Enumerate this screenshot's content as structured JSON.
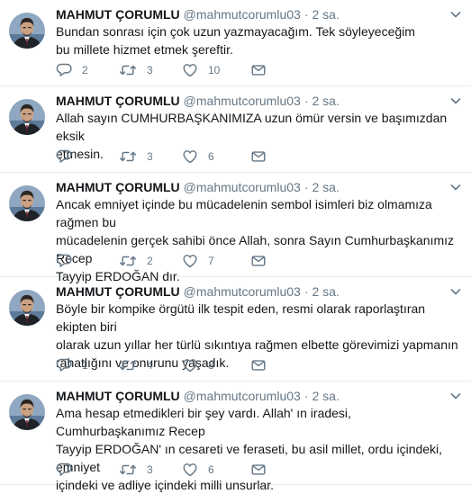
{
  "tweets": [
    {
      "author_name": "MAHMUT ÇORUMLU",
      "handle": "@mahmutcorumlu03",
      "separator": "·",
      "time": "2 sa.",
      "text": "Bundan sonrası için çok uzun yazmayacağım. Tek söyleyeceğim\nbu millete hizmet etmek şereftir.",
      "replies": "2",
      "retweets": "3",
      "likes": "10"
    },
    {
      "author_name": "MAHMUT ÇORUMLU",
      "handle": "@mahmutcorumlu03",
      "separator": "·",
      "time": "2 sa.",
      "text": "Allah sayın CUMHURBAŞKANIMIZA uzun ömür versin ve başımızdan eksik\netmesin.",
      "replies": "",
      "retweets": "3",
      "likes": "6"
    },
    {
      "author_name": "MAHMUT ÇORUMLU",
      "handle": "@mahmutcorumlu03",
      "separator": "·",
      "time": "2 sa.",
      "text": "Ancak emniyet içinde bu mücadelenin sembol isimleri biz olmamıza rağmen bu\nmücadelenin gerçek sahibi önce Allah, sonra Sayın Cumhurbaşkanımız Recep\nTayyip ERDOĞAN dır.",
      "replies": "",
      "retweets": "2",
      "likes": "7"
    },
    {
      "author_name": "MAHMUT ÇORUMLU",
      "handle": "@mahmutcorumlu03",
      "separator": "·",
      "time": "2 sa.",
      "text": "Böyle bir kompike örgütü ilk tespit eden, resmi olarak raporlaştıran ekipten biri\nolarak uzun yıllar her türlü sıkıntıya rağmen  elbette görevimizi yapmanın\nrahatlığını ve onurunu yaşadık.",
      "replies": "1",
      "retweets": "4",
      "likes": "8"
    },
    {
      "author_name": "MAHMUT ÇORUMLU",
      "handle": "@mahmutcorumlu03",
      "separator": "·",
      "time": "2 sa.",
      "text": "Ama hesap etmedikleri bir şey vardı. Allah' ın iradesi,  Cumhurbaşkanımız Recep\nTayyip ERDOĞAN' ın cesareti ve feraseti, bu asil millet, ordu içindeki, emniyet\niçindeki ve adliye içindeki milli unsurlar.",
      "replies": "",
      "retweets": "3",
      "likes": "6"
    }
  ],
  "colors": {
    "text": "#14171a",
    "secondary": "#657786",
    "divider": "#e6ecf0"
  },
  "icons": {
    "reply": "reply-icon",
    "retweet": "retweet-icon",
    "like": "heart-icon",
    "message": "envelope-icon",
    "more": "chevron-down-icon"
  }
}
